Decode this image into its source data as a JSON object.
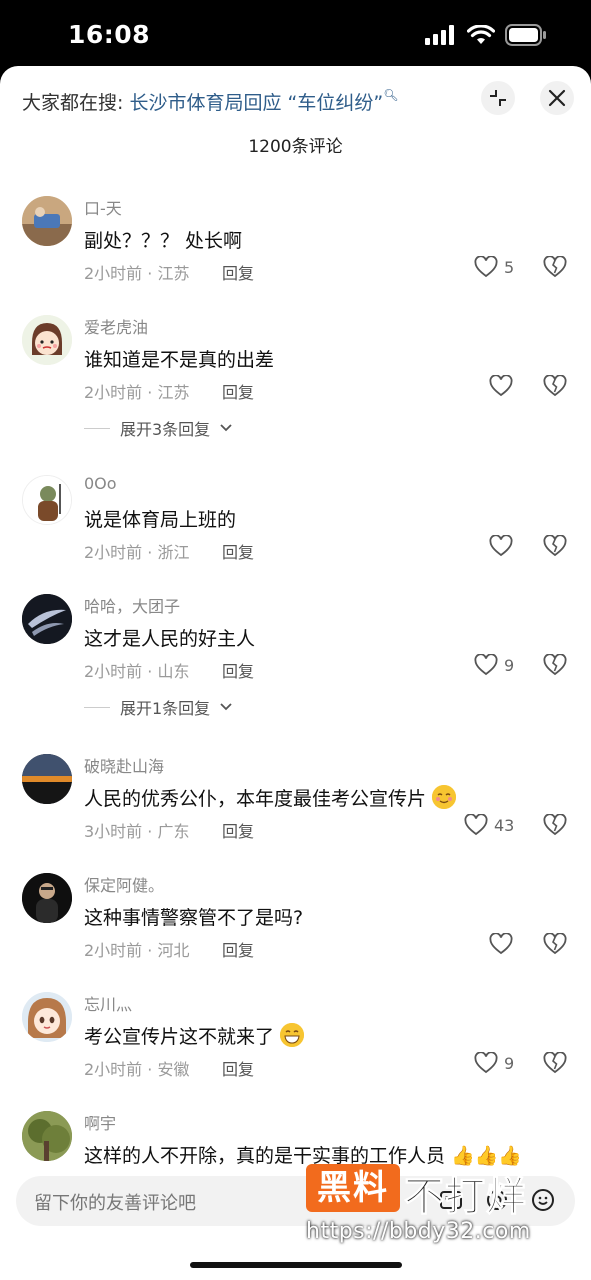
{
  "status": {
    "time": "16:08"
  },
  "header": {
    "hint_prefix": "大家都在搜:",
    "hint_link": "长沙市体育局回应 “车位纠纷”",
    "comment_count": "1200条评论"
  },
  "comments": [
    {
      "user": "口-天",
      "text": "副处？？？ 处长啊",
      "meta": "2小时前 · 江苏",
      "reply": "回复",
      "likes": "5"
    },
    {
      "user": "爱老虎油",
      "text": "谁知道是不是真的出差",
      "meta": "2小时前 · 江苏",
      "reply": "回复",
      "likes": "",
      "expand": "展开3条回复"
    },
    {
      "user": "0Oo",
      "text": "说是体育局上班的",
      "meta": "2小时前 · 浙江",
      "reply": "回复",
      "likes": ""
    },
    {
      "user": "哈哈，大团子",
      "text": "这才是人民的好主人",
      "meta": "2小时前 · 山东",
      "reply": "回复",
      "likes": "9",
      "expand": "展开1条回复"
    },
    {
      "user": "破晓赴山海",
      "text": "人民的优秀公仆，本年度最佳考公宣传片",
      "meta": "3小时前 · 广东",
      "reply": "回复",
      "likes": "43"
    },
    {
      "user": "保定阿健。",
      "text": "这种事情警察管不了是吗?",
      "meta": "2小时前 · 河北",
      "reply": "回复",
      "likes": ""
    },
    {
      "user": "忘川灬",
      "text": "考公宣传片这不就来了",
      "meta": "2小时前 · 安徽",
      "reply": "回复",
      "likes": "9"
    },
    {
      "user": "啊宇",
      "text": "这样的人不开除，真的是干实事的工作人员",
      "meta": "",
      "reply": "",
      "likes": ""
    }
  ],
  "input": {
    "placeholder": "留下你的友善评论吧"
  },
  "watermark": {
    "box": "黑料",
    "text": "不打烊",
    "url": "https://bbdy32.com"
  },
  "colors": {
    "link": "#2f5d8a",
    "watermark": "#f26b1d"
  }
}
